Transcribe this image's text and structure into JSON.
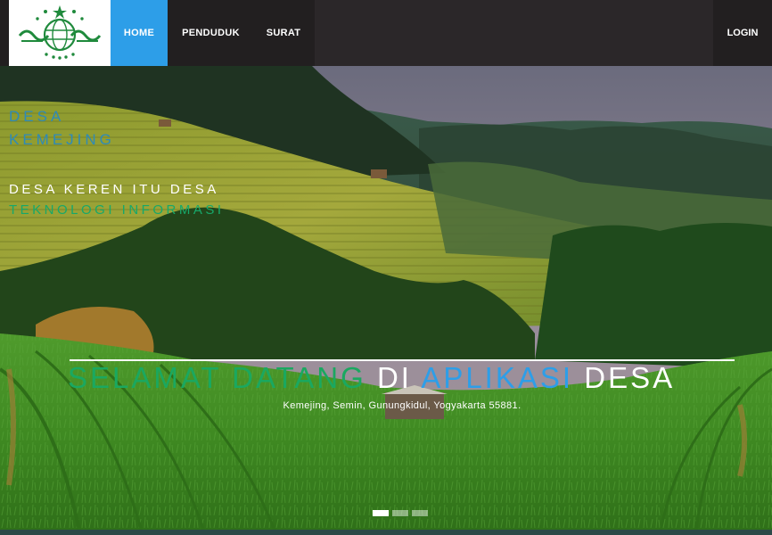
{
  "nav": {
    "brand_logo_text": "NU",
    "items": [
      {
        "label": "HOME"
      },
      {
        "label": "PENDUDUK"
      },
      {
        "label": "SURAT"
      }
    ],
    "login_label": "LOGIN",
    "active_color": "#2d9ee8"
  },
  "hero": {
    "title_line1": "DESA",
    "title_line2": "KEMEJING",
    "tagline_line1": "DESA KEREN ITU DESA",
    "tagline_line2": "TEKNOLOGI INFORMASI",
    "welcome": {
      "part1": "SELAMAT DATANG",
      "part2": "DI",
      "part3": "APLIKASI",
      "part4": "DESA"
    },
    "address": "Kemejing, Semin, Gunungkidul, Yogyakarta 55881.",
    "slides_count": 3,
    "active_slide": 1
  },
  "colors": {
    "accent_blue": "#2d9ee8",
    "accent_green": "#1aa860",
    "navbar_bg": "#221f20"
  }
}
